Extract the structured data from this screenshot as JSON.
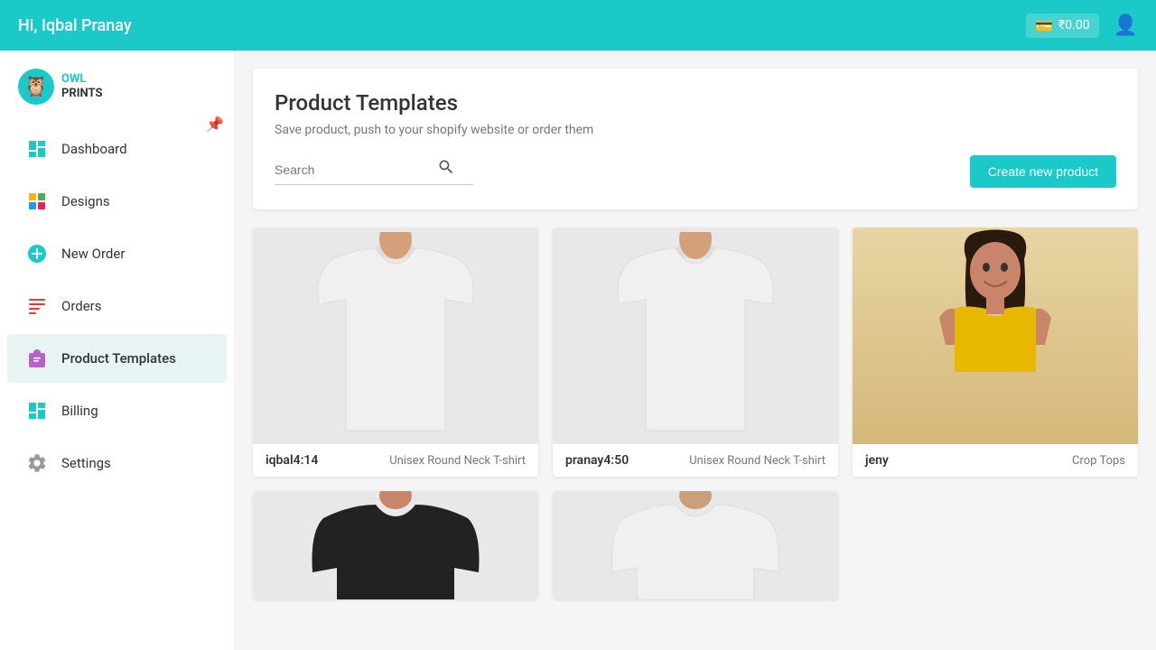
{
  "header": {
    "greeting": "Hi, Iqbal Pranay",
    "wallet_amount": "₹0.00",
    "wallet_icon": "💳"
  },
  "sidebar": {
    "logo_text": "OWL\nPRINTS",
    "items": [
      {
        "id": "dashboard",
        "label": "Dashboard",
        "icon": "🏠",
        "active": false
      },
      {
        "id": "designs",
        "label": "Designs",
        "icon": "🎨",
        "active": false
      },
      {
        "id": "new-order",
        "label": "New Order",
        "icon": "📋",
        "active": false
      },
      {
        "id": "orders",
        "label": "Orders",
        "icon": "📦",
        "active": false
      },
      {
        "id": "product-templates",
        "label": "Product Templates",
        "icon": "👕",
        "active": true
      },
      {
        "id": "billing",
        "label": "Billing",
        "icon": "🏠",
        "active": false
      },
      {
        "id": "settings",
        "label": "Settings",
        "icon": "⚙️",
        "active": false
      }
    ]
  },
  "main": {
    "page_title": "Product Templates",
    "page_subtitle": "Save product, push to your shopify website or order them",
    "search_placeholder": "Search",
    "create_btn_label": "Create new product",
    "products": [
      {
        "id": 1,
        "name": "iqbal4:14",
        "type": "Unisex Round Neck T-shirt",
        "bg": "light",
        "color": "white",
        "style": "tshirt"
      },
      {
        "id": 2,
        "name": "pranay4:50",
        "type": "Unisex Round Neck T-shirt",
        "bg": "light",
        "color": "white",
        "style": "tshirt"
      },
      {
        "id": 3,
        "name": "jeny",
        "type": "Crop Tops",
        "bg": "warm",
        "color": "yellow",
        "style": "croptop"
      },
      {
        "id": 4,
        "name": "",
        "type": "",
        "bg": "light",
        "color": "black",
        "style": "longsleeve"
      },
      {
        "id": 5,
        "name": "",
        "type": "",
        "bg": "light",
        "color": "white",
        "style": "tshirt"
      }
    ]
  }
}
